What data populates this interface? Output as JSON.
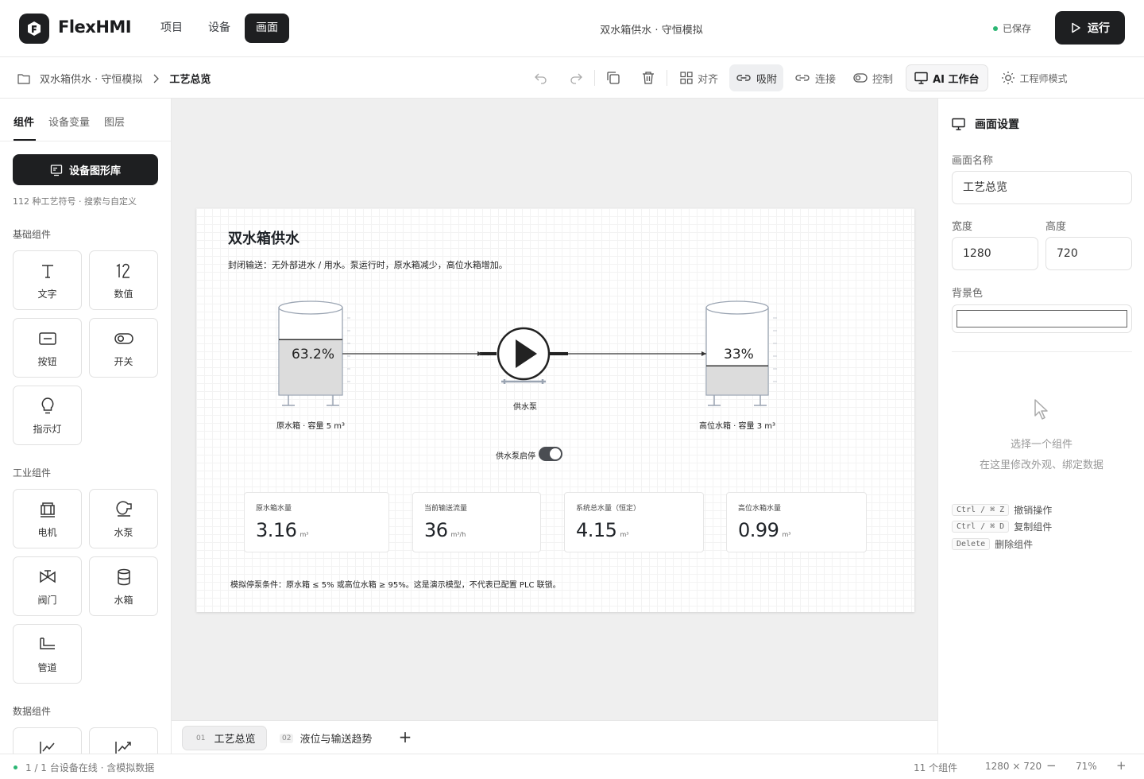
{
  "header": {
    "brand": "FlexHMI",
    "nav": [
      {
        "label": "项目"
      },
      {
        "label": "设备"
      },
      {
        "label": "画面"
      }
    ],
    "doc_title": "双水箱供水 · 守恒模拟",
    "saved": "已保存",
    "run": "运行"
  },
  "toolbar": {
    "breadcrumb_root": "双水箱供水 · 守恒模拟",
    "breadcrumb_current": "工艺总览",
    "align": "对齐",
    "snap": "吸附",
    "connect": "连接",
    "control": "控制",
    "ai": "AI 工作台",
    "engineer": "工程师模式"
  },
  "sidebar": {
    "tabs": [
      "组件",
      "设备变量",
      "图层"
    ],
    "library_button": "设备图形库",
    "library_note": "112 种工艺符号 · 搜索与自定义",
    "sections": [
      "基础组件",
      "工业组件",
      "数据组件"
    ],
    "basic": [
      "文字",
      "数值",
      "按钮",
      "开关",
      "指示灯"
    ],
    "industrial": [
      "电机",
      "水泵",
      "阀门",
      "水箱",
      "管道"
    ]
  },
  "screen": {
    "title": "双水箱供水",
    "description": "封闭输送：无外部进水 / 用水。泵运行时，原水箱减少，高位水箱增加。",
    "tank_left_label": "原水箱 · 容量 5 m³",
    "tank_left_pct": "63.2%",
    "tank_left_level": 0.632,
    "tank_right_label": "高位水箱 · 容量 3 m³",
    "tank_right_pct": "33%",
    "tank_right_level": 0.33,
    "pump_label": "供水泵",
    "toggle_label": "供水泵启停",
    "stats": [
      {
        "label": "原水箱水量",
        "value": "3.16",
        "unit": "m³"
      },
      {
        "label": "当前输送流量",
        "value": "36",
        "unit": "m³/h"
      },
      {
        "label": "系统总水量（恒定）",
        "value": "4.15",
        "unit": "m³"
      },
      {
        "label": "高位水箱水量",
        "value": "0.99",
        "unit": "m³"
      }
    ],
    "note": "模拟停泵条件：原水箱 ≤ 5% 或高位水箱 ≥ 95%。这是演示模型，不代表已配置 PLC 联锁。"
  },
  "page_tabs": [
    {
      "num": "01",
      "label": "工艺总览"
    },
    {
      "num": "02",
      "label": "液位与输送趋势"
    }
  ],
  "inspector": {
    "title": "画面设置",
    "name_label": "画面名称",
    "name_value": "工艺总览",
    "width_label": "宽度",
    "width_value": "1280",
    "height_label": "高度",
    "height_value": "720",
    "bg_label": "背景色",
    "bg_value": "#ffffff",
    "hint1": "选择一个组件",
    "hint2": "在这里修改外观、绑定数据",
    "shortcuts": [
      {
        "key": "Ctrl / ⌘ Z",
        "label": "撤销操作"
      },
      {
        "key": "Ctrl / ⌘ D",
        "label": "复制组件"
      },
      {
        "key": "Delete",
        "label": "删除组件"
      }
    ]
  },
  "status": {
    "devices": "1 / 1 台设备在线 · 含模拟数据",
    "components": "11 个组件",
    "size": "1280 × 720",
    "zoom_out": "−",
    "zoom": "71%",
    "zoom_in": "+"
  },
  "colors": {
    "accent_dark": "#1e1f21",
    "online": "#2bb673",
    "canvas_bg": "#efefef"
  }
}
